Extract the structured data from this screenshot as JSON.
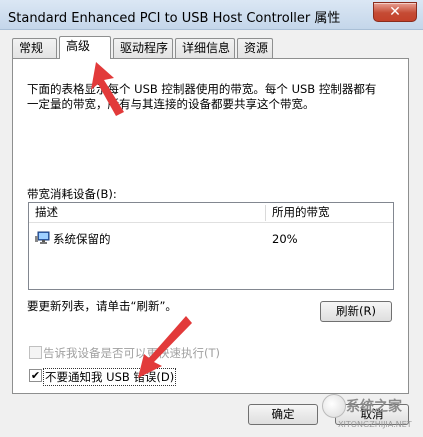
{
  "window": {
    "title": "Standard Enhanced PCI to USB Host Controller 属性",
    "close_label": "✕"
  },
  "tabs": [
    {
      "label": "常规",
      "active": false
    },
    {
      "label": "高级",
      "active": true
    },
    {
      "label": "驱动程序",
      "active": false
    },
    {
      "label": "详细信息",
      "active": false
    },
    {
      "label": "资源",
      "active": false
    }
  ],
  "advanced": {
    "description": "下面的表格显示每个 USB 控制器使用的带宽。每个 USB 控制器都有一定量的带宽，所有与其连接的设备都要共享这个带宽。",
    "group_label": "带宽消耗设备(B):",
    "list": {
      "columns": [
        "描述",
        "所用的带宽"
      ],
      "rows": [
        {
          "description": "系统保留的",
          "bandwidth": "20%"
        }
      ]
    },
    "refresh_text": "要更新列表，请单击“刷新”。",
    "refresh_button": "刷新(R)",
    "options": [
      {
        "label": "告诉我设备是否可以更快速执行(T)",
        "checked": false,
        "enabled": false
      },
      {
        "label": "不要通知我 USB 错误(D)",
        "checked": true,
        "enabled": true
      }
    ]
  },
  "footer": {
    "ok_button": "确定",
    "cancel_button": "取消"
  },
  "watermark": {
    "text": "系统之家",
    "sub": "XITONGZHIJIA.NET"
  },
  "colors": {
    "annotation_arrow": "#e23a3a",
    "close_button": "#c54b34"
  }
}
